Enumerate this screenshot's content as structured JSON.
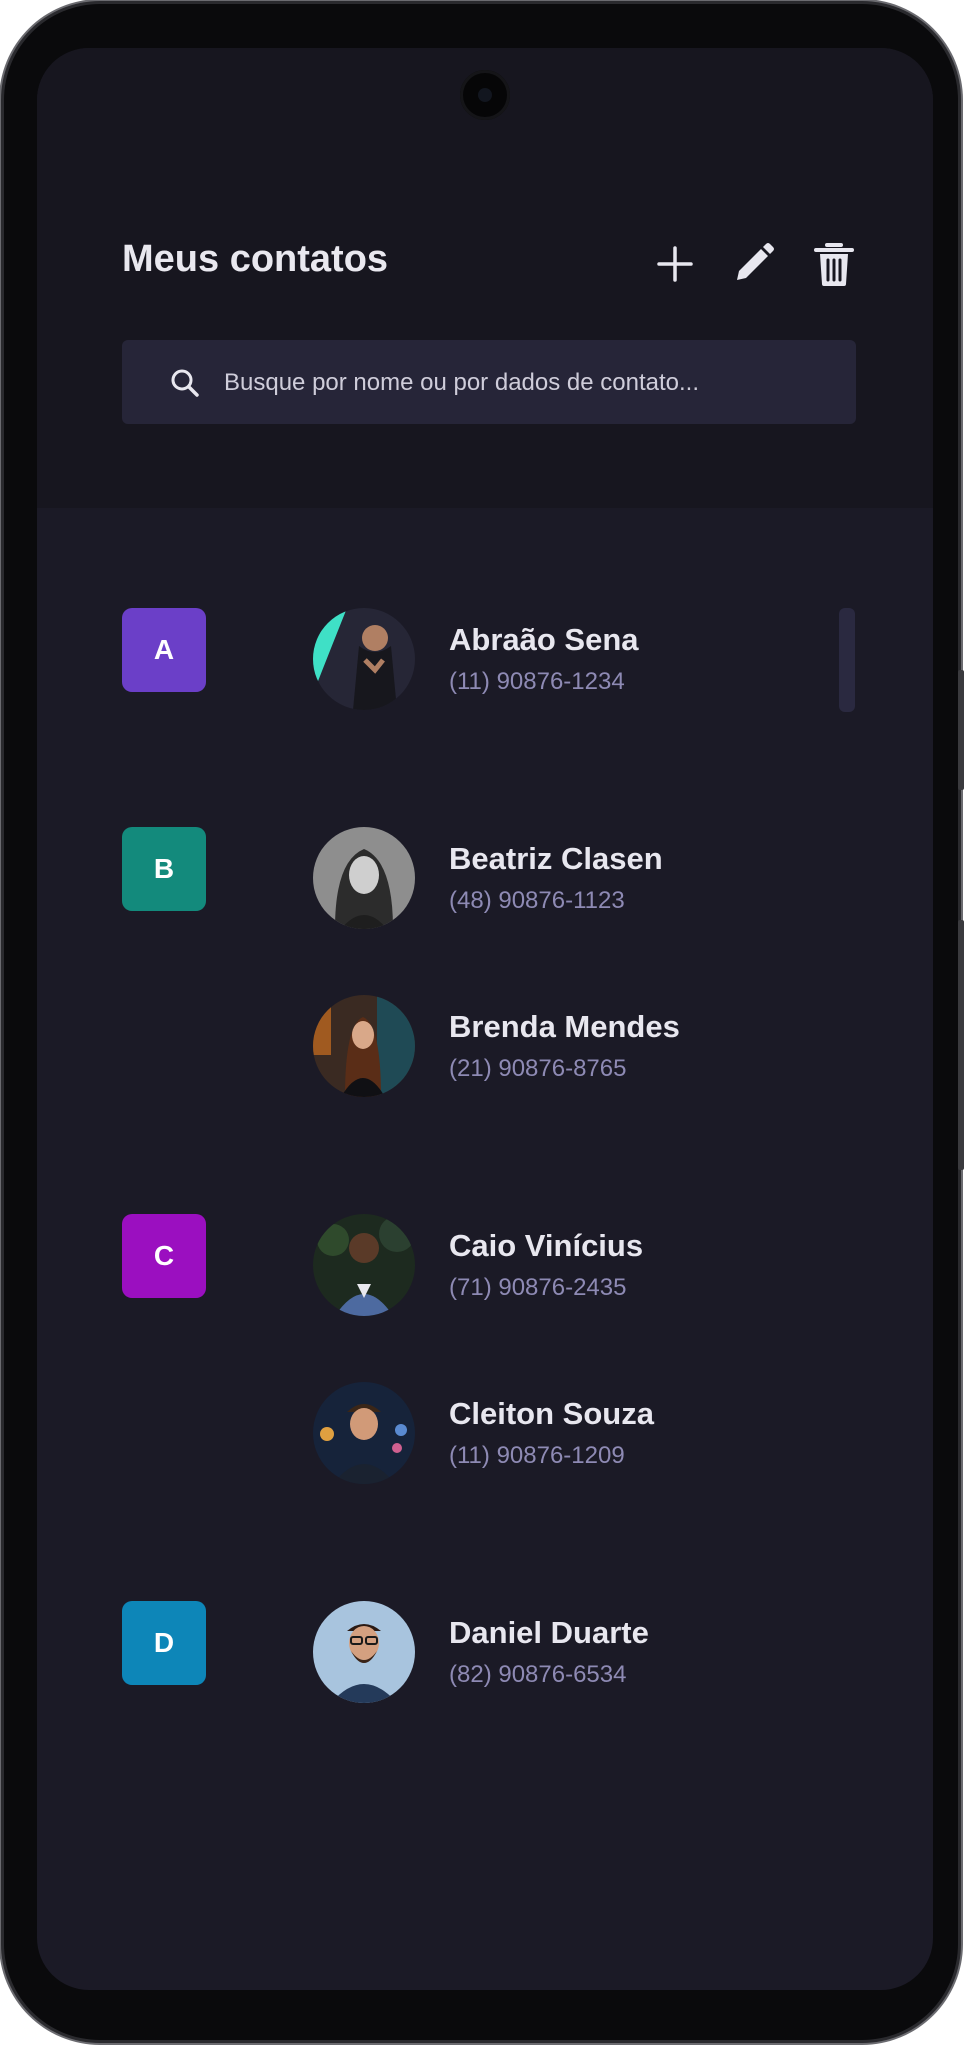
{
  "header": {
    "title": "Meus contatos",
    "add_icon": "plus-icon",
    "edit_icon": "pencil-icon",
    "delete_icon": "trash-icon"
  },
  "search": {
    "placeholder": "Busque por nome ou por dados de contato..."
  },
  "colors": {
    "screen_background": "#1b1a26",
    "header_background": "#17161f",
    "search_background": "#262538",
    "phone_text": "#8e8ab4",
    "badge_a": "#6b3fc8",
    "badge_b": "#138a7c",
    "badge_c": "#9b0fc0",
    "badge_d": "#0d86b8"
  },
  "groups": [
    {
      "letter": "A",
      "color": "#6b3fc8",
      "contacts": [
        {
          "name": "Abraão Sena",
          "phone": "(11) 90876-1234"
        }
      ]
    },
    {
      "letter": "B",
      "color": "#138a7c",
      "contacts": [
        {
          "name": "Beatriz Clasen",
          "phone": "(48) 90876-1123"
        },
        {
          "name": "Brenda Mendes",
          "phone": "(21) 90876-8765"
        }
      ]
    },
    {
      "letter": "C",
      "color": "#9b0fc0",
      "contacts": [
        {
          "name": "Caio Vinícius",
          "phone": "(71) 90876-2435"
        },
        {
          "name": "Cleiton Souza",
          "phone": "(11) 90876-1209"
        }
      ]
    },
    {
      "letter": "D",
      "color": "#0d86b8",
      "contacts": [
        {
          "name": "Daniel Duarte",
          "phone": "(82) 90876-6534"
        }
      ]
    }
  ]
}
